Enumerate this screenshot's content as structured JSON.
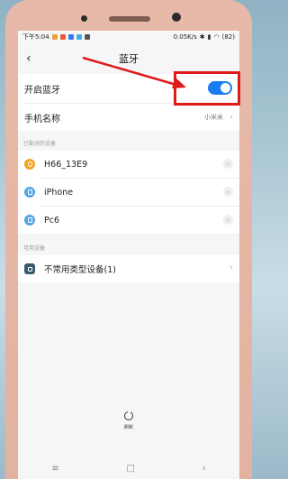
{
  "status_bar": {
    "time": "下午5:04",
    "speed": "0.05K/s",
    "battery": "(82)"
  },
  "header": {
    "back": "‹",
    "title": "蓝牙"
  },
  "bluetooth": {
    "label": "开启蓝牙",
    "enabled": true
  },
  "phone_name": {
    "label": "手机名称",
    "value": "小米米",
    "chevron": "›"
  },
  "paired_section": {
    "title": "已配对的设备"
  },
  "paired_devices": [
    {
      "name": "H66_13E9",
      "icon": "headset-icon",
      "color": "#f0a623"
    },
    {
      "name": "iPhone",
      "icon": "phone-icon",
      "color": "#53a6e8"
    },
    {
      "name": "Pc6",
      "icon": "phone-icon",
      "color": "#53a6e8"
    }
  ],
  "available_section": {
    "title": "可用设备"
  },
  "available_devices": [
    {
      "name": "不常用类型设备(1)",
      "icon": "device-icon",
      "color": "#3a5a6e"
    }
  ],
  "refresh": {
    "label": "刷新"
  },
  "system_nav": {
    "menu": "≡",
    "home": "□",
    "back": "‹"
  },
  "colors": {
    "toggle": "#1a7cf2",
    "annotation": "#e01a1a"
  }
}
